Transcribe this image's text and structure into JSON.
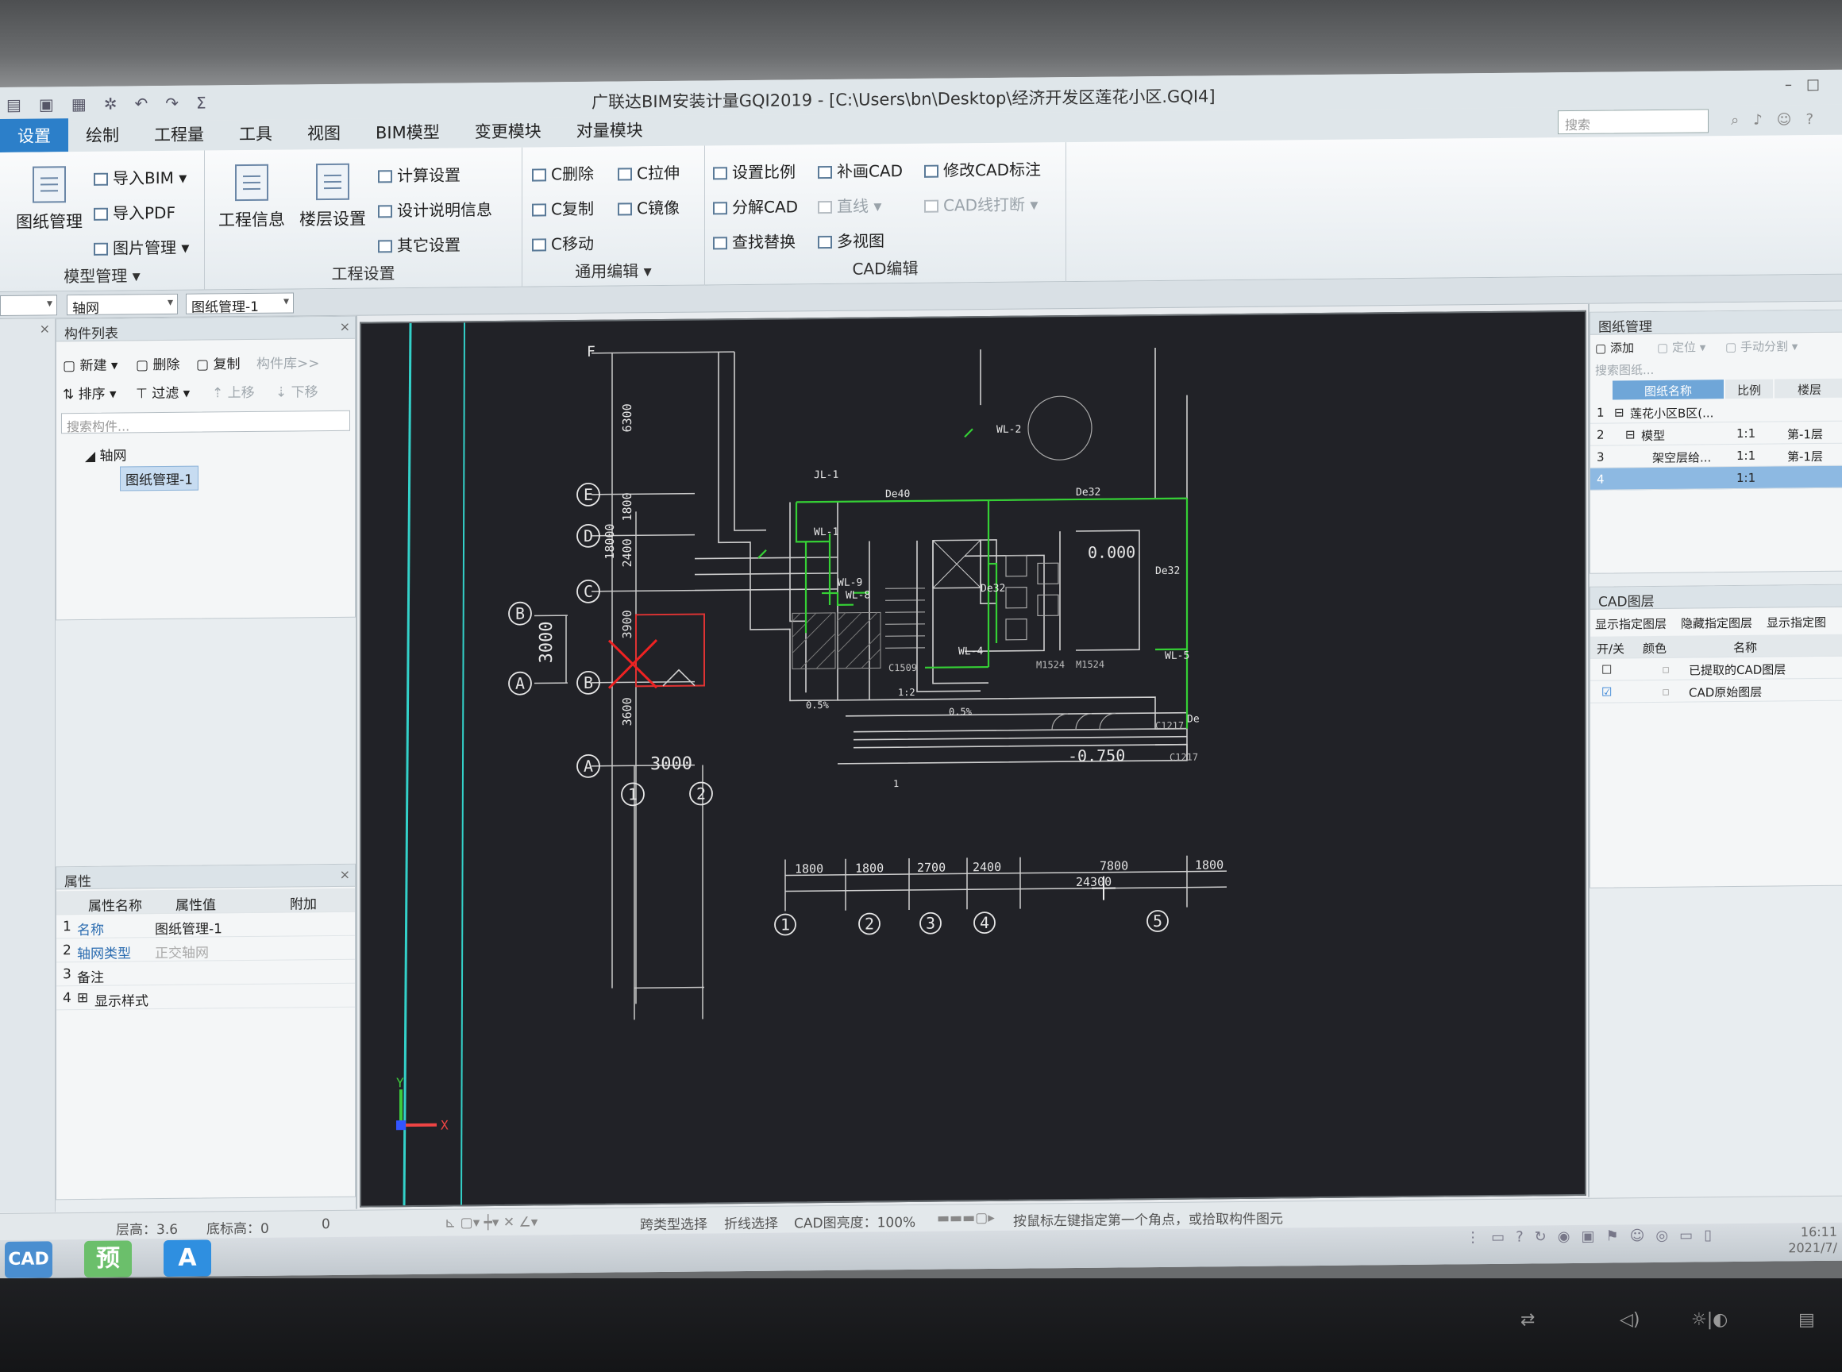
{
  "window": {
    "title": "广联达BIM安装计量GQI2019 - [C:\\Users\\bn\\Desktop\\经济开发区莲花小区.GQI4]",
    "search_placeholder": "搜索"
  },
  "menu_tabs": [
    "设置",
    "绘制",
    "工程量",
    "工具",
    "视图",
    "BIM模型",
    "变更模块",
    "对量模块"
  ],
  "ribbon": {
    "model_mgmt": {
      "big_label": "图纸管理",
      "items": [
        "导入BIM",
        "导入PDF",
        "图片管理"
      ],
      "group_label": "模型管理"
    },
    "project_settings": {
      "big_buttons": [
        "工程信息",
        "楼层设置"
      ],
      "items": [
        "计算设置",
        "设计说明信息",
        "其它设置"
      ],
      "group_label": "工程设置"
    },
    "general_edit": {
      "items": [
        "C删除",
        "C拉伸",
        "C复制",
        "C镜像",
        "C移动"
      ],
      "group_label": "通用编辑"
    },
    "cad_edit": {
      "items": [
        "设置比例",
        "补画CAD",
        "修改CAD标注",
        "分解CAD",
        "直线",
        "CAD线打断",
        "查找替换",
        "多视图"
      ],
      "group_label": "CAD编辑"
    }
  },
  "combos": {
    "first": "",
    "axis": "轴网",
    "drawing": "图纸管理-1"
  },
  "component_list": {
    "title": "构件列表",
    "tools": [
      "新建",
      "删除",
      "复制",
      "构件库>>",
      "排序",
      "过滤",
      "上移",
      "下移"
    ],
    "search_placeholder": "搜索构件...",
    "tree_root": "轴网",
    "tree_child": "图纸管理-1"
  },
  "properties": {
    "title": "属性",
    "headers": [
      "属性名称",
      "属性值",
      "附加"
    ],
    "rows": [
      {
        "no": "1",
        "name": "名称",
        "value": "图纸管理-1"
      },
      {
        "no": "2",
        "name": "轴网类型",
        "value": "正交轴网"
      },
      {
        "no": "3",
        "name": "备注",
        "value": ""
      },
      {
        "no": "4",
        "name": "显示样式",
        "value": ""
      }
    ]
  },
  "drawing_manager": {
    "title": "图纸管理",
    "tools": [
      "添加",
      "定位",
      "手动分割"
    ],
    "search_placeholder": "搜索图纸...",
    "headers": [
      "图纸名称",
      "比例",
      "楼层"
    ],
    "rows": [
      {
        "no": "1",
        "name": "莲花小区B区(...",
        "scale": "",
        "floor": ""
      },
      {
        "no": "2",
        "name": "模型",
        "scale": "1:1",
        "floor": "第-1层"
      },
      {
        "no": "3",
        "name": "架空层给...",
        "scale": "1:1",
        "floor": "第-1层"
      },
      {
        "no": "4",
        "name": "",
        "scale": "1:1",
        "floor": ""
      }
    ]
  },
  "cad_layers": {
    "title": "CAD图层",
    "tools": [
      "显示指定图层",
      "隐藏指定图层",
      "显示指定图"
    ],
    "headers": [
      "开/关",
      "颜色",
      "名称"
    ],
    "rows": [
      {
        "checked": false,
        "name": "已提取的CAD图层"
      },
      {
        "checked": true,
        "name": "CAD原始图层"
      }
    ]
  },
  "statusbar": {
    "floor_height": "层高：3.6",
    "bottom_elev": "底标高：0",
    "zero": "0",
    "cross_select": "跨类型选择",
    "polyline_select": "折线选择",
    "cad_brightness": "CAD图亮度：100%",
    "hint": "按鼠标左键指定第一个角点，或拾取构件图元"
  },
  "taskbar": {
    "apps": [
      "CAD",
      "预",
      "A"
    ],
    "clock": [
      "16:11",
      "2021/7/"
    ]
  },
  "cad_drawing": {
    "axes_letters_small": [
      "F",
      "E",
      "D",
      "C",
      "B",
      "A"
    ],
    "dims_vertical": [
      "6300",
      "1800",
      "2400",
      "3900",
      "3600",
      "18000"
    ],
    "axis_labels": [
      "B",
      "A",
      "B",
      "A",
      "1",
      "2"
    ],
    "dim_3000_v": "3000",
    "dim_3000_h": "3000",
    "bottom_dims": [
      "1800",
      "1800",
      "2700",
      "2400",
      "7800",
      "1800"
    ],
    "total_dim": "24300",
    "bottom_axes": [
      "1",
      "2",
      "3",
      "4",
      "5"
    ],
    "elevations": [
      "0.000",
      "-0.750"
    ],
    "pipe_labels": [
      "WL-2",
      "JL-1",
      "WL-1",
      "WL-9",
      "WL-8",
      "WL-4",
      "WL-5",
      "De40",
      "De32",
      "De32",
      "De32",
      "De"
    ],
    "door_labels": [
      "M1524",
      "M1524",
      "C1509",
      "C1217",
      "C1217"
    ],
    "misc_text": [
      "0.5%",
      "1:2",
      "0.5%",
      "1"
    ],
    "ucs_x": "X",
    "ucs_y": "Y"
  }
}
